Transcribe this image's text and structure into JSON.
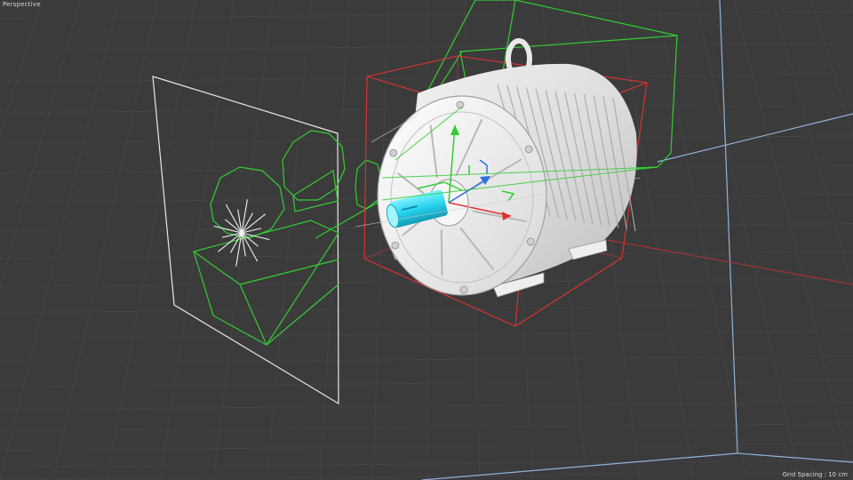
{
  "viewport": {
    "label": "Perspective",
    "grid_spacing": "Grid Spacing : 10 cm"
  },
  "colors": {
    "background": "#3b3b3b",
    "grid_line": "#464646",
    "bounding_box": "#e23232",
    "camera_frustum": "#33cc33",
    "axis_x": "#e03030",
    "axis_y": "#33cc33",
    "axis_z": "#2f6fe0",
    "selected_shaft": "#2fd8f0",
    "model_body": "#e6e6e6",
    "room_edges": "#8fb3dc"
  },
  "scene": {
    "objects": [
      "camera-frustum",
      "light-gizmo",
      "motor-model",
      "bounding-box",
      "transform-gizmo",
      "motor-shaft"
    ]
  }
}
